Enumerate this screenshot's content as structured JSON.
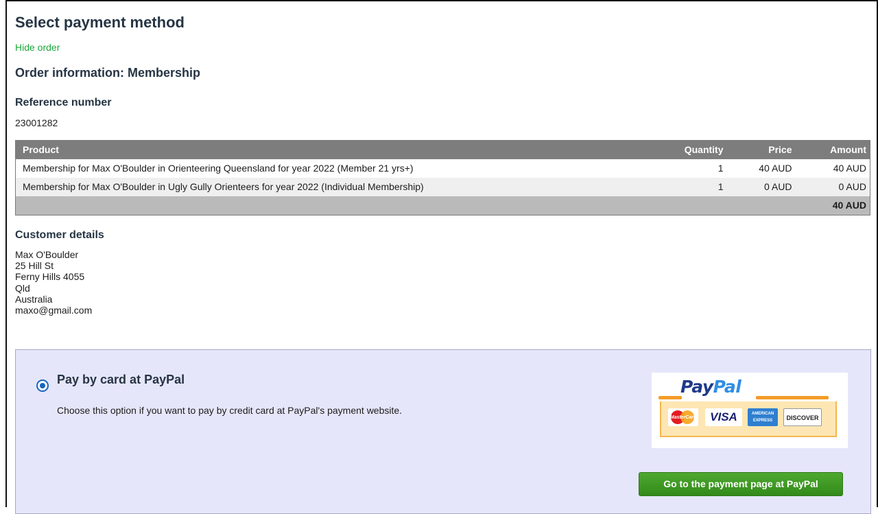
{
  "page": {
    "title": "Select payment method",
    "hide_order_link": "Hide order"
  },
  "order": {
    "heading": "Order information: Membership",
    "reference_label": "Reference number",
    "reference_value": "23001282",
    "columns": [
      "Product",
      "Quantity",
      "Price",
      "Amount"
    ],
    "rows": [
      {
        "product": "Membership for Max O'Boulder in Orienteering Queensland for year 2022 (Member 21 yrs+)",
        "quantity": "1",
        "price": "40 AUD",
        "amount": "40 AUD"
      },
      {
        "product": "Membership for Max O'Boulder in Ugly Gully Orienteers for year 2022 (Individual Membership)",
        "quantity": "1",
        "price": "0 AUD",
        "amount": "0 AUD"
      }
    ],
    "total": "40 AUD"
  },
  "customer": {
    "label": "Customer details",
    "name": "Max O'Boulder",
    "street": "25 Hill St",
    "suburb": "Ferny Hills 4055",
    "state": "Qld",
    "country": "Australia",
    "email": "maxo@gmail.com"
  },
  "payment": {
    "selected": true,
    "title": "Pay by card at PayPal",
    "description": "Choose this option if you want to pay by credit card at PayPal's payment website.",
    "logo": {
      "word_pay": "Pay",
      "word_pal": "Pal",
      "cards": [
        "MasterCard",
        "VISA",
        "AMERICAN EXPRESS",
        "DISCOVER"
      ]
    },
    "button_label": "Go to the payment page at PayPal"
  },
  "colors": {
    "heading": "#263544",
    "link": "#1aa839",
    "table_header": "#7d7d7d",
    "payment_box": "#e6e6fa",
    "button": "#338a1a"
  }
}
